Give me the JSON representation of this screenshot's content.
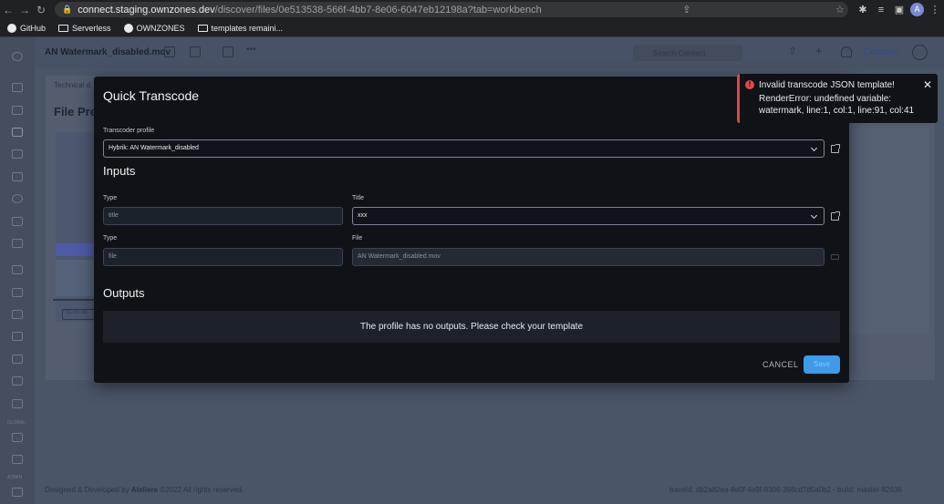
{
  "browser": {
    "url_host": "connect.staging.ownzones.dev",
    "url_path": "/discover/files/0e513538-566f-4bb7-8e06-6047eb12198a?tab=workbench",
    "profile_initial": "A",
    "bookmarks": [
      "GitHub",
      "Serverless",
      "OWNZONES",
      "templates remaini..."
    ]
  },
  "app": {
    "file_title": "AN Watermark_disabled.mov",
    "search_placeholder": "Search Connect",
    "workspace": "Discover",
    "breadcrumb": "Technical d",
    "page_title": "File Pre",
    "timecode": "01:00:00",
    "footer_copy_prefix": "Designed & Developed by",
    "footer_brand": "Ateliere",
    "footer_copy_suffix": "©2022 All rights reserved.",
    "footer_trace": "traceId: db2a82ea-8e0f-4a9f-9306-398cd7d5a0b2 - build: master-82936",
    "nav_sections": [
      "GLOBAL",
      "ADMIN"
    ]
  },
  "modal": {
    "title": "Quick Transcode",
    "profile_label": "Transcoder profile",
    "profile_value": "Hybrik: AN Watermark_disabled",
    "inputs_title": "Inputs",
    "row1": {
      "type_label": "Type",
      "type_value": "title",
      "title_label": "Title",
      "title_value": "xxx"
    },
    "row2": {
      "type_label": "Type",
      "type_value": "file",
      "file_label": "File",
      "file_value": "AN Watermark_disabled.mov"
    },
    "outputs_title": "Outputs",
    "outputs_empty": "The profile has no outputs. Please check your template",
    "cancel_label": "CANCEL",
    "save_label": "Save"
  },
  "toast": {
    "title": "Invalid transcode JSON template!",
    "message": "RenderError: undefined variable: watermark, line:1, col:1, line:91, col:41"
  },
  "colors": {
    "accent": "#3d9be9",
    "error": "#e04848",
    "modal_bg": "#0f1217",
    "overlay": "#4a5568"
  }
}
